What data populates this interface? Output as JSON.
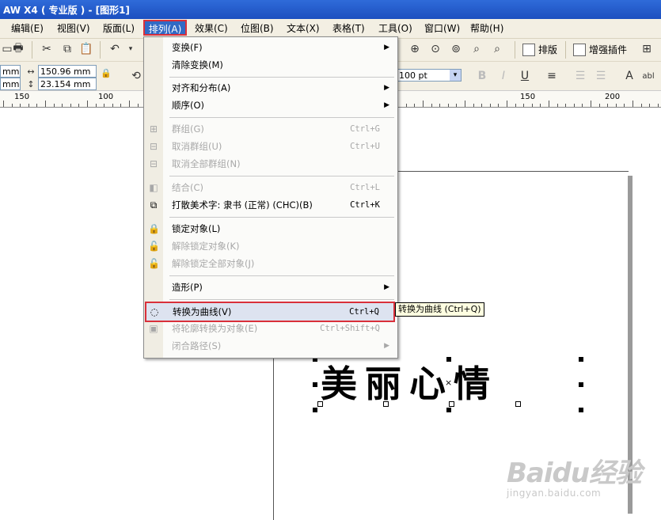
{
  "window": {
    "title": "AW X4 ( 专业版 ) - [图形1]"
  },
  "menubar": {
    "items": [
      "编辑(E)",
      "视图(V)",
      "版面(L)",
      "排列(A)",
      "效果(C)",
      "位图(B)",
      "文本(X)",
      "表格(T)",
      "工具(O)",
      "窗口(W)",
      "帮助(H)"
    ]
  },
  "toolbar": {
    "layout_label": "排版",
    "plugins_label": "增强插件",
    "width_value": "150.96 mm",
    "height_value": "23.154 mm",
    "partial_x": "mm",
    "partial_y": "mm",
    "font_size_value": "100 pt"
  },
  "ruler": {
    "labels": [
      "150",
      "100",
      "150",
      "200"
    ]
  },
  "arrange_menu": {
    "items": [
      {
        "label": "变换(F)",
        "shortcut": "",
        "submenu": true,
        "disabled": false
      },
      {
        "label": "清除变换(M)",
        "shortcut": "",
        "submenu": false,
        "disabled": false
      },
      {
        "label": "对齐和分布(A)",
        "shortcut": "",
        "submenu": true,
        "disabled": false
      },
      {
        "label": "顺序(O)",
        "shortcut": "",
        "submenu": true,
        "disabled": false
      },
      {
        "label": "群组(G)",
        "shortcut": "Ctrl+G",
        "submenu": false,
        "disabled": true
      },
      {
        "label": "取消群组(U)",
        "shortcut": "Ctrl+U",
        "submenu": false,
        "disabled": true
      },
      {
        "label": "取消全部群组(N)",
        "shortcut": "",
        "submenu": false,
        "disabled": true
      },
      {
        "label": "结合(C)",
        "shortcut": "Ctrl+L",
        "submenu": false,
        "disabled": true
      },
      {
        "label": "打散美术字: 隶书 (正常) (CHC)(B)",
        "shortcut": "Ctrl+K",
        "submenu": false,
        "disabled": false
      },
      {
        "label": "锁定对象(L)",
        "shortcut": "",
        "submenu": false,
        "disabled": false
      },
      {
        "label": "解除锁定对象(K)",
        "shortcut": "",
        "submenu": false,
        "disabled": true
      },
      {
        "label": "解除锁定全部对象(J)",
        "shortcut": "",
        "submenu": false,
        "disabled": true
      },
      {
        "label": "造形(P)",
        "shortcut": "",
        "submenu": true,
        "disabled": false
      },
      {
        "label": "转换为曲线(V)",
        "shortcut": "Ctrl+Q",
        "submenu": false,
        "disabled": false
      },
      {
        "label": "将轮廓转换为对象(E)",
        "shortcut": "Ctrl+Shift+Q",
        "submenu": false,
        "disabled": true
      },
      {
        "label": "闭合路径(S)",
        "shortcut": "",
        "submenu": true,
        "disabled": true
      }
    ]
  },
  "tooltip": {
    "text": "转换为曲线 (Ctrl+Q)"
  },
  "canvas": {
    "art_text": "美丽心情"
  },
  "watermark": {
    "main": "Baidu经验",
    "sub": "jingyan.baidu.com"
  }
}
